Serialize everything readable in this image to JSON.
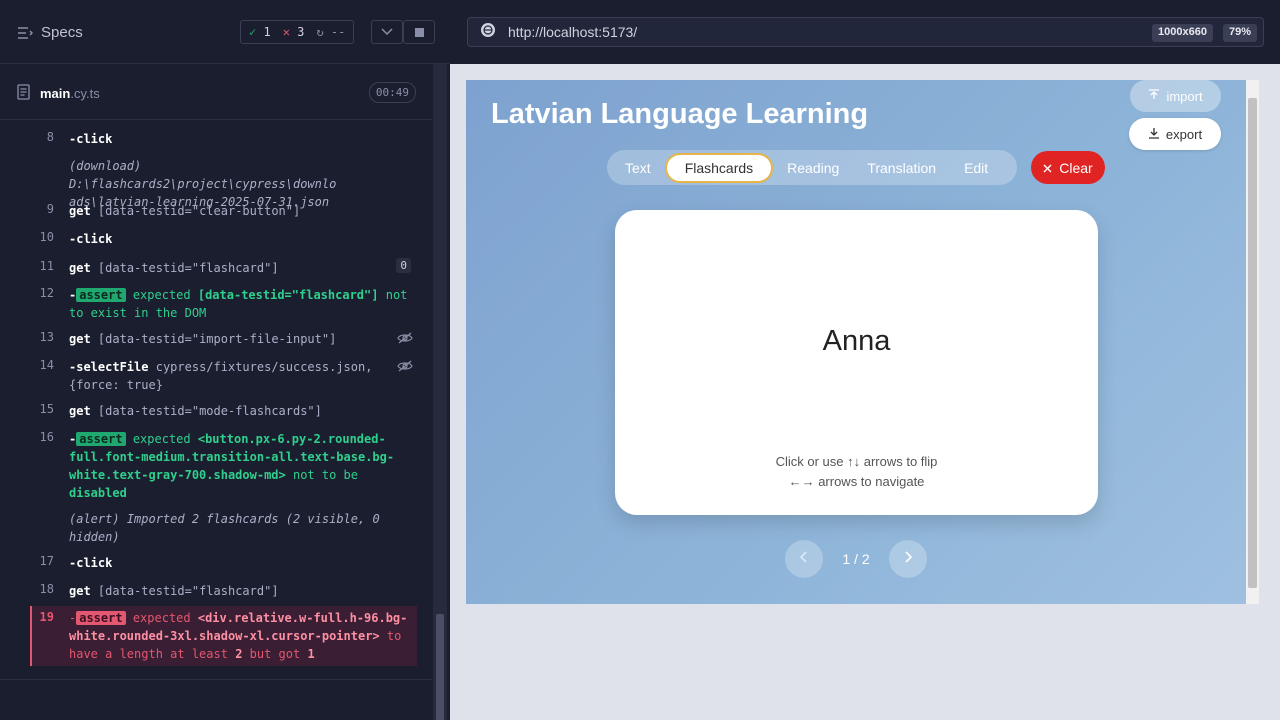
{
  "runner": {
    "specs_label": "Specs",
    "passed": "1",
    "failed": "3",
    "pending": "--",
    "file_name": "main",
    "file_ext": ".cy.ts",
    "timer": "00:49"
  },
  "commands": [
    {
      "num": "8",
      "lines": [
        [
          "cmd",
          "-click"
        ]
      ]
    },
    {
      "num": "",
      "lines": [
        [
          "it",
          "(download)"
        ],
        [
          "sel",
          " D:\\flashcards2\\project\\cypress\\downlo"
        ]
      ],
      "line2": "ads\\latvian-learning-2025-07-31.json"
    },
    {
      "num": "9",
      "cmd": "get",
      "arg": "[data-testid=\"clear-button\"]"
    },
    {
      "num": "10",
      "cmd": "-click"
    },
    {
      "num": "11",
      "cmd": "get",
      "arg": "[data-testid=\"flashcard\"]",
      "badge": "0"
    },
    {
      "num": "12",
      "assert": "assert",
      "text1": "expected",
      "target": "[data-testid=\"flashcard\"]",
      "text2": "not",
      "line2": "to exist in the DOM"
    },
    {
      "num": "13",
      "cmd": "get",
      "arg": "[data-testid=\"import-file-input\"]"
    },
    {
      "num": "14",
      "cmd": "-selectFile",
      "arg": "cypress/fixtures/success.json,",
      "line2": "{force: true}"
    },
    {
      "num": "15",
      "cmd": "get",
      "arg": "[data-testid=\"mode-flashcards\"]"
    },
    {
      "num": "16",
      "assert": "assert",
      "text1": "expected",
      "target_l1": "<button.px-6.py-2.rounded-",
      "target_l2": "full.font-medium.transition-all.text-base.bg-",
      "target_l3": "white.text-gray-700.shadow-md>",
      "text2": "not to be",
      "line4": "disabled"
    },
    {
      "num": "",
      "alert": "(alert)",
      "alert_text": "Imported 2 flashcards (2 visible, 0",
      "line2": "hidden)"
    },
    {
      "num": "17",
      "cmd": "-click"
    },
    {
      "num": "18",
      "cmd": "get",
      "arg": "[data-testid=\"flashcard\"]"
    },
    {
      "num": "19",
      "assert": "assert",
      "text1": "expected",
      "target_l1": "<div.relative.w-full.h-96.bg-",
      "target_l2": "white.rounded-3xl.shadow-xl.cursor-pointer>",
      "text2": "to",
      "line3a": "have a length at least",
      "v1": "2",
      "line3b": "but got",
      "v2": "1"
    }
  ],
  "browser": {
    "url": "http://localhost:5173/",
    "viewport": "1000x660",
    "zoom": "79%"
  },
  "app": {
    "title": "Latvian Language Learning",
    "import_label": "import",
    "export_label": "export",
    "tabs": [
      "Text",
      "Flashcards",
      "Reading",
      "Translation",
      "Edit"
    ],
    "active_tab": "Flashcards",
    "clear_label": "Clear",
    "card_word": "Anna",
    "hint_line1": "Click or use ↑↓ arrows to flip",
    "hint_line2": "←→ arrows to navigate",
    "pager": "1 / 2"
  },
  "colors": {
    "pass": "#1fa971",
    "fail": "#e45770",
    "clear": "#e02424",
    "active_border": "#e6b54a"
  }
}
